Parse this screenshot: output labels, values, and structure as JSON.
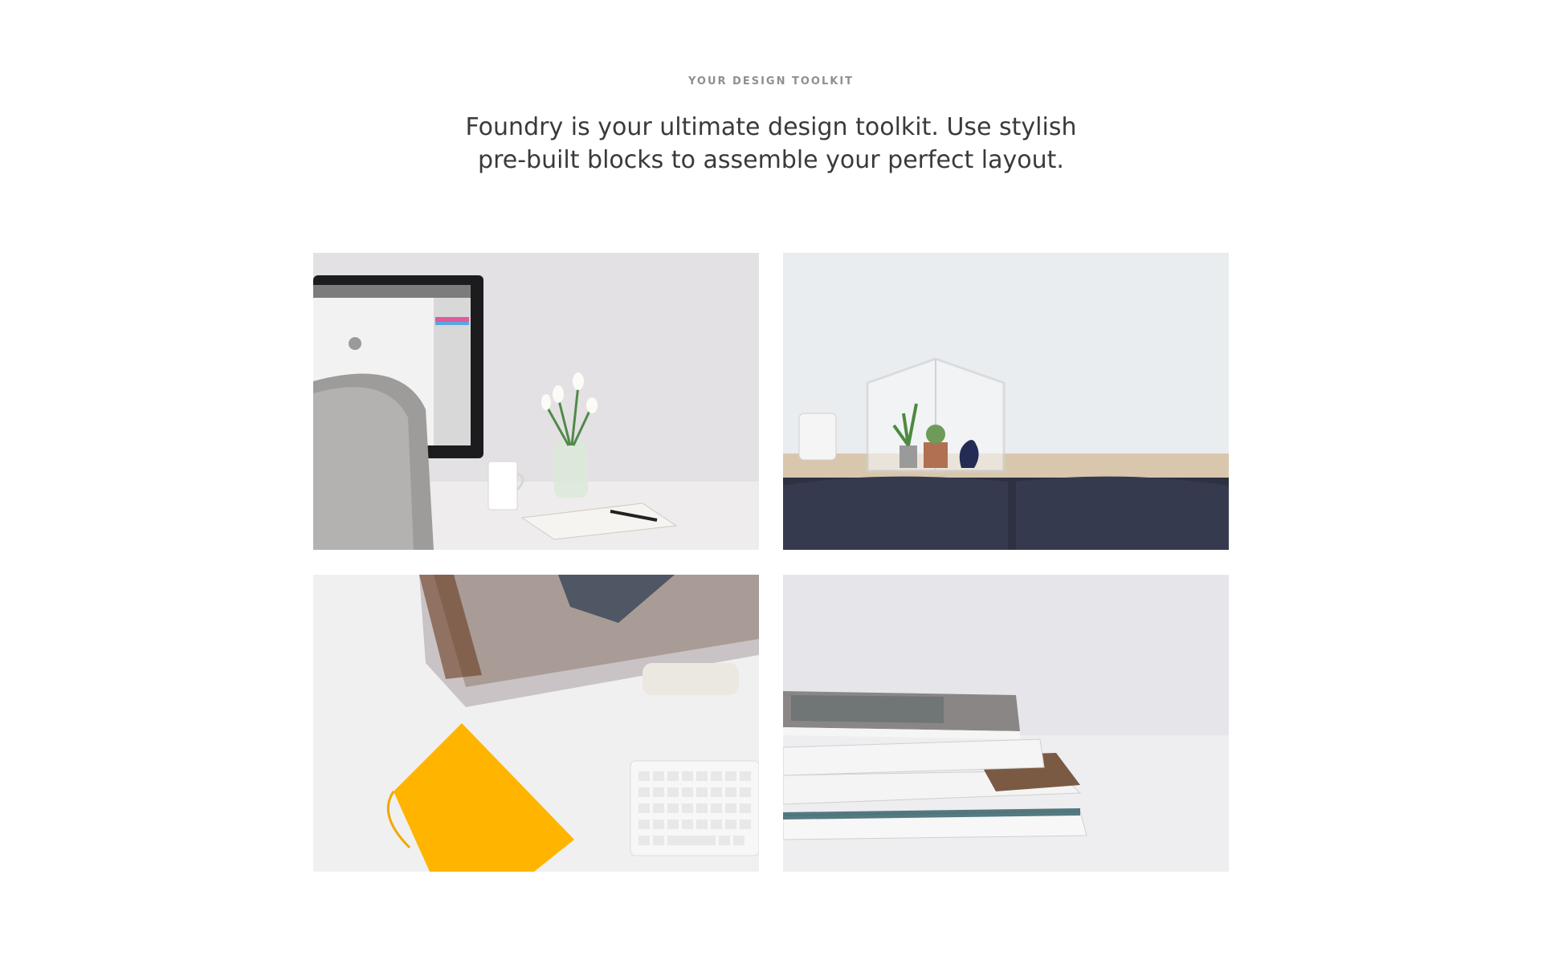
{
  "header": {
    "eyebrow": "YOUR DESIGN TOOLKIT",
    "lead_line1": "Foundry is your ultimate design toolkit. Use stylish",
    "lead_line2": "pre-built blocks to assemble your perfect layout."
  },
  "gallery": {
    "images": [
      {
        "subject": "desk with monitor, tulips, mug and notebook"
      },
      {
        "subject": "mini greenhouse with plants on shelf above dark sofa"
      },
      {
        "subject": "top-down desk with yellow notebook and keyboard"
      },
      {
        "subject": "stack of magazines on table"
      }
    ]
  },
  "colors": {
    "background": "#ffffff",
    "eyebrow": "#8f8f8f",
    "lead": "#3a3a3a",
    "accent_yellow": "#ffb400",
    "sofa": "#2e3142"
  }
}
